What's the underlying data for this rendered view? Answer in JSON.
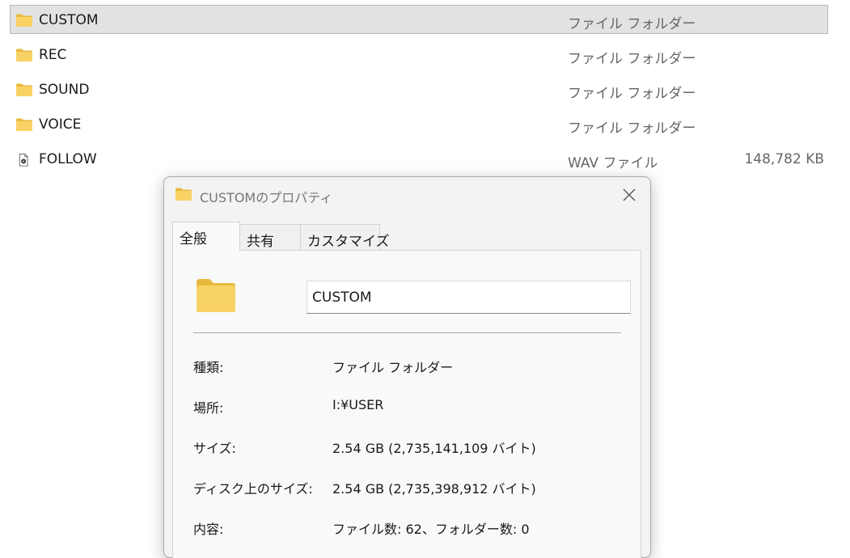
{
  "files": [
    {
      "name": "CUSTOM",
      "type": "ファイル フォルダー",
      "size": "",
      "icon": "folder-icon",
      "selected": true
    },
    {
      "name": "REC",
      "type": "ファイル フォルダー",
      "size": "",
      "icon": "folder-icon",
      "selected": false
    },
    {
      "name": "SOUND",
      "type": "ファイル フォルダー",
      "size": "",
      "icon": "folder-icon",
      "selected": false
    },
    {
      "name": "VOICE",
      "type": "ファイル フォルダー",
      "size": "",
      "icon": "folder-icon",
      "selected": false
    },
    {
      "name": "FOLLOW",
      "type": "WAV ファイル",
      "size": "148,782 KB",
      "icon": "audio-file-icon",
      "selected": false
    }
  ],
  "dialog": {
    "title": "CUSTOMのプロパティ",
    "tabs": [
      {
        "label": "全般",
        "active": true
      },
      {
        "label": "共有",
        "active": false
      },
      {
        "label": "カスタマイズ",
        "active": false
      }
    ],
    "name_value": "CUSTOM",
    "properties": [
      {
        "label": "種類:",
        "value": "ファイル フォルダー"
      },
      {
        "label": "場所:",
        "value": "I:¥USER"
      },
      {
        "label": "サイズ:",
        "value": "2.54 GB (2,735,141,109 バイト)"
      },
      {
        "label": "ディスク上のサイズ:",
        "value": "2.54 GB (2,735,398,912 バイト)"
      },
      {
        "label": "内容:",
        "value": "ファイル数: 62、フォルダー数: 0"
      }
    ]
  },
  "colors": {
    "selected_row": "#e2e2e2",
    "folder_yellow": "#f8d264",
    "dialog_bg": "#f3f3f3"
  }
}
